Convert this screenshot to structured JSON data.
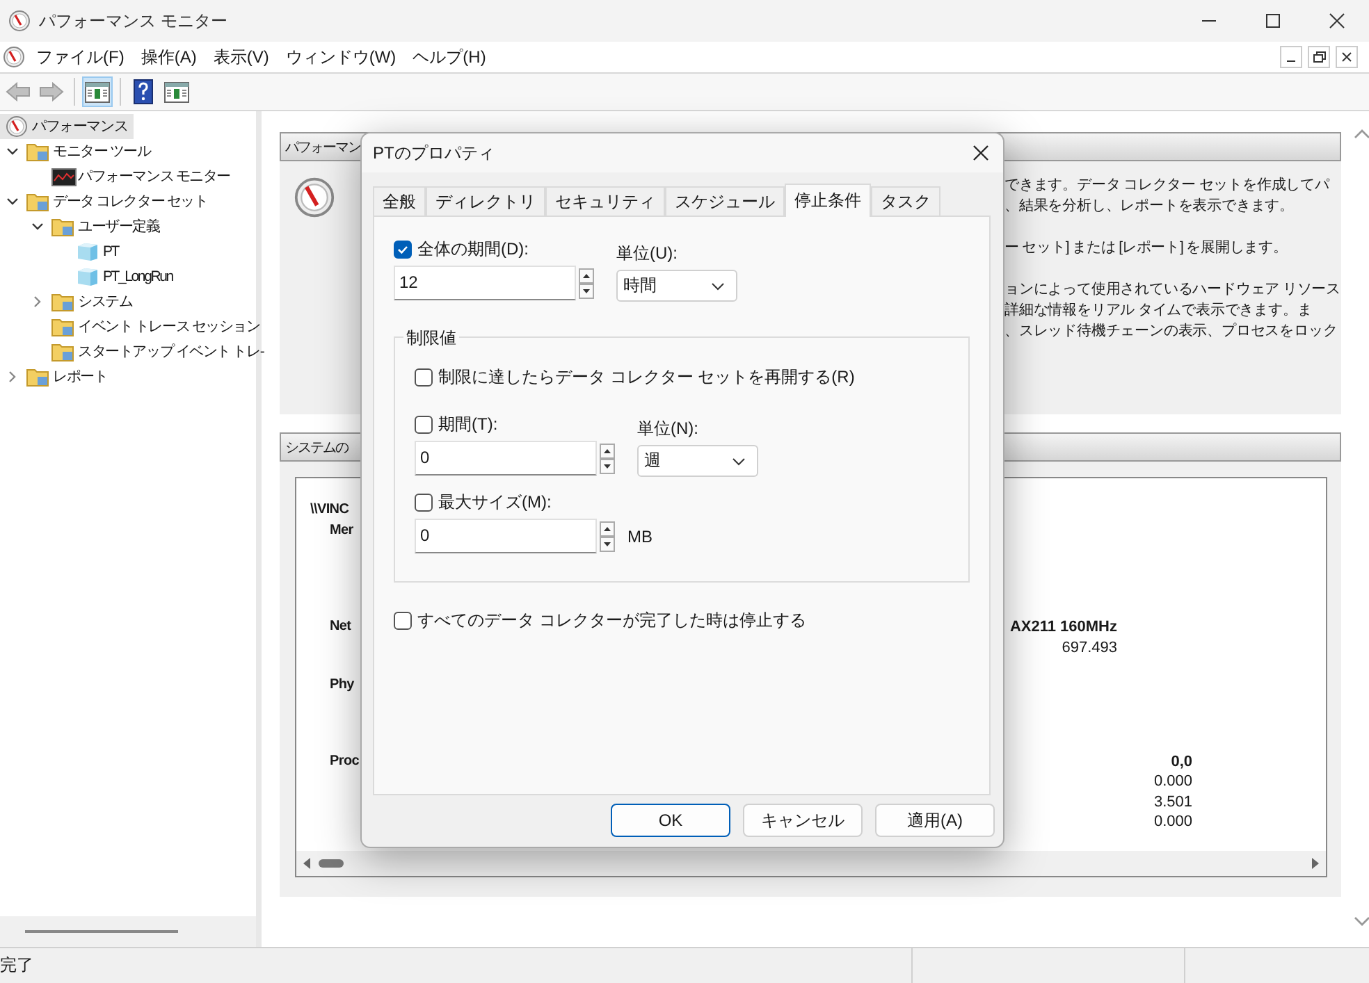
{
  "window": {
    "title": "パフォーマンス モニター"
  },
  "menu": [
    "ファイル(F)",
    "操作(A)",
    "表示(V)",
    "ウィンドウ(W)",
    "ヘルプ(H)"
  ],
  "toolbar": [
    {
      "kind": "back",
      "disabled": true,
      "on": false
    },
    {
      "kind": "forward",
      "disabled": true,
      "on": false
    },
    {
      "kind": "console-tree",
      "disabled": false,
      "on": true
    },
    {
      "kind": "help",
      "disabled": false,
      "on": false
    },
    {
      "kind": "action-pane",
      "disabled": false,
      "on": false
    }
  ],
  "tree": [
    {
      "label": "パフォーマンス",
      "kind": "gauge",
      "selected": true,
      "children": [
        {
          "label": "モニター ツール",
          "kind": "folder",
          "selected": false,
          "expanded": true,
          "children": [
            {
              "label": "パフォーマンス モニター",
              "kind": "chart",
              "selected": false
            }
          ]
        },
        {
          "label": "データ コレクター セット",
          "kind": "folder",
          "selected": false,
          "expanded": true,
          "children": [
            {
              "label": "ユーザー定義",
              "kind": "folder",
              "selected": false,
              "expanded": true,
              "children": [
                {
                  "label": "PT",
                  "kind": "cube",
                  "selected": false
                },
                {
                  "label": "PT_LongRun",
                  "kind": "cube",
                  "selected": false
                }
              ]
            },
            {
              "label": "システム",
              "kind": "folder",
              "selected": false,
              "expanded": false
            },
            {
              "label": "イベント トレース セッション",
              "kind": "folder",
              "selected": false
            },
            {
              "label": "スタートアップ イベント トレ-",
              "kind": "folder",
              "selected": false
            }
          ]
        },
        {
          "label": "レポート",
          "kind": "folder",
          "selected": false,
          "expanded": false
        }
      ]
    }
  ],
  "overview": {
    "title": "パフォーマン",
    "paragraphs": [
      [
        "できます。データ コレクター セットを作成してパ",
        "、結果を分析し、レポートを表示できます。"
      ],
      [
        "ー セット] または [レポート] を展開します。"
      ],
      [
        "ョンによって使用されているハードウェア リソース",
        "詳細な情報をリアル タイムで表示できます。ま",
        "、スレッド待機チェーンの表示、プロセスをロック"
      ]
    ]
  },
  "summary": {
    "title": "システムの",
    "sections": [
      [
        {
          "kind": "machine",
          "label": "\\\\VINC"
        },
        {
          "kind": "object",
          "label": "Mer"
        }
      ],
      [
        {
          "kind": "object",
          "label": "Net",
          "column_1": "AX211 160MHz"
        },
        {
          "kind": "value",
          "column_1": "697.493"
        }
      ],
      [
        {
          "kind": "object",
          "label": "Phy"
        }
      ],
      [
        {
          "kind": "object",
          "label": "Proc",
          "column_2": "0,0"
        },
        {
          "kind": "value",
          "column_2": "0.000"
        },
        {
          "kind": "value",
          "column_2": "3.501"
        },
        {
          "kind": "value",
          "column_2": "0.000"
        }
      ]
    ]
  },
  "dialog": {
    "title": "PTのプロパティ",
    "tabs": [
      {
        "label": "全般",
        "selected": false
      },
      {
        "label": "ディレクトリ",
        "selected": false
      },
      {
        "label": "セキュリティ",
        "selected": false
      },
      {
        "label": "スケジュール",
        "selected": false
      },
      {
        "label": "停止条件",
        "selected": true
      },
      {
        "label": "タスク",
        "selected": false
      }
    ],
    "duration": {
      "label": "全体の期間(D):",
      "checked": true,
      "value": "12"
    },
    "unit": {
      "label": "単位(U):",
      "value": "時間"
    },
    "limits": {
      "title": "制限値",
      "restart": {
        "label": "制限に達したらデータ コレクター セットを再開する(R)",
        "checked": false
      },
      "period": {
        "label": "期間(T):",
        "checked": false,
        "value": "0"
      },
      "period_unit": {
        "label": "単位(N):",
        "value": "週"
      },
      "max_size": {
        "label": "最大サイズ(M):",
        "checked": false,
        "value": "0",
        "unit": "MB"
      }
    },
    "stop_when_complete": {
      "label": "すべてのデータ コレクターが完了した時は停止する",
      "checked": false
    },
    "buttons": [
      {
        "label": "OK",
        "kind": "default"
      },
      {
        "label": "キャンセル",
        "kind": "normal"
      },
      {
        "label": "適用(A)",
        "kind": "normal"
      }
    ]
  },
  "status_bar": "完了"
}
